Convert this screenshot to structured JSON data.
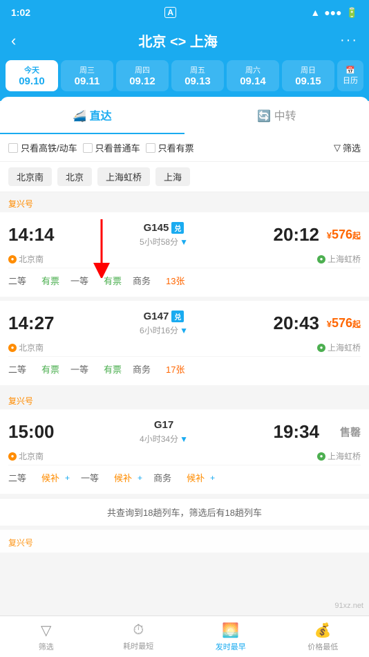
{
  "statusBar": {
    "time": "1:02",
    "icon": "A"
  },
  "header": {
    "title": "北京 <> 上海",
    "backLabel": "‹",
    "moreLabel": "···"
  },
  "dates": [
    {
      "id": "today",
      "dayName": "今天",
      "dayNum": "09.10",
      "isActive": true,
      "isToday": true
    },
    {
      "id": "wed",
      "dayName": "周三",
      "dayNum": "09.11",
      "isActive": false
    },
    {
      "id": "thu",
      "dayName": "周四",
      "dayNum": "09.12",
      "isActive": false
    },
    {
      "id": "fri",
      "dayName": "周五",
      "dayNum": "09.13",
      "isActive": false
    },
    {
      "id": "sat",
      "dayName": "周六",
      "dayNum": "09.14",
      "isActive": false
    },
    {
      "id": "sun",
      "dayName": "周日",
      "dayNum": "09.15",
      "isActive": false
    }
  ],
  "calendarBtn": {
    "icon": "📅",
    "label": "日历"
  },
  "tabs": [
    {
      "id": "direct",
      "label": "直达",
      "icon": "🚄",
      "isActive": true
    },
    {
      "id": "transfer",
      "label": "中转",
      "icon": "🔄",
      "isActive": false
    }
  ],
  "filters": [
    {
      "id": "highspeed",
      "label": "只看高铁/动车",
      "checked": false
    },
    {
      "id": "ordinary",
      "label": "只看普通车",
      "checked": false
    },
    {
      "id": "available",
      "label": "只看有票",
      "checked": false
    }
  ],
  "filterBtn": {
    "icon": "▽",
    "label": "筛选"
  },
  "stationTags": [
    "北京南",
    "北京",
    "上海虹桥",
    "上海"
  ],
  "trains": [
    {
      "id": "g145",
      "category": "复兴号",
      "departTime": "14:14",
      "departStation": "北京南",
      "departDot": "orange",
      "trainNumber": "G145",
      "trainBadge": "兑",
      "duration": "5小时58分",
      "arriveTime": "20:12",
      "arriveStation": "上海虹桥",
      "arriveDot": "green",
      "price": "¥576起",
      "soldOut": false,
      "tickets": [
        {
          "type": "二等",
          "status": "有票",
          "available": true
        },
        {
          "type": "一等",
          "status": "有票",
          "available": true
        },
        {
          "type": "商务",
          "count": "13张",
          "hasCount": true
        }
      ]
    },
    {
      "id": "g147",
      "category": "",
      "departTime": "14:27",
      "departStation": "北京南",
      "departDot": "orange",
      "trainNumber": "G147",
      "trainBadge": "兑",
      "duration": "6小时16分",
      "arriveTime": "20:43",
      "arriveStation": "上海虹桥",
      "arriveDot": "green",
      "price": "¥576起",
      "soldOut": false,
      "tickets": [
        {
          "type": "二等",
          "status": "有票",
          "available": true
        },
        {
          "type": "一等",
          "status": "有票",
          "available": true
        },
        {
          "type": "商务",
          "count": "17张",
          "hasCount": true
        }
      ]
    },
    {
      "id": "g17",
      "category": "复兴号",
      "departTime": "15:00",
      "departStation": "北京南",
      "departDot": "orange",
      "trainNumber": "G17",
      "trainBadge": "",
      "duration": "4小时34分",
      "arriveTime": "19:34",
      "arriveStation": "上海虹桥",
      "arriveDot": "green",
      "price": "售罄",
      "soldOut": true,
      "tickets": [
        {
          "type": "二等",
          "status": "候补",
          "supplement": true
        },
        {
          "type": "一等",
          "status": "候补",
          "supplement": true
        },
        {
          "type": "商务",
          "status": "候补",
          "supplement": true
        }
      ]
    }
  ],
  "summary": "共查询到18趟列车，筛选后有18趟列车",
  "bottomNav": [
    {
      "id": "filter",
      "icon": "▽",
      "label": "筛选",
      "active": false
    },
    {
      "id": "shortest",
      "icon": "⏱",
      "label": "耗时最短",
      "active": false
    },
    {
      "id": "earliest",
      "icon": "🌅",
      "label": "发时最早",
      "active": true
    },
    {
      "id": "price",
      "icon": "💰",
      "label": "价格最低",
      "active": false
    }
  ]
}
